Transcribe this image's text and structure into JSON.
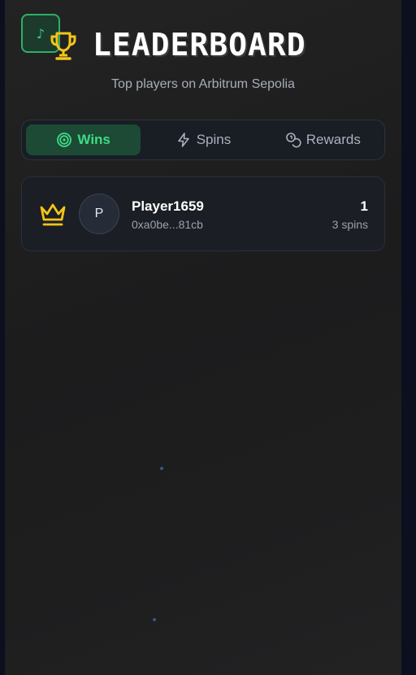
{
  "header": {
    "app_icon": "music-note-icon",
    "trophy_icon": "trophy-icon",
    "title": "LEADERBOARD",
    "subtitle": "Top players on Arbitrum Sepolia"
  },
  "tabs": [
    {
      "label": "Wins",
      "icon": "target-icon",
      "active": true
    },
    {
      "label": "Spins",
      "icon": "lightning-icon",
      "active": false
    },
    {
      "label": "Rewards",
      "icon": "coins-icon",
      "active": false
    }
  ],
  "leaderboard": [
    {
      "rank_icon": "crown-icon",
      "avatar_initial": "P",
      "name": "Player1659",
      "address": "0xa0be...81cb",
      "score": "1",
      "spins": "3 spins"
    }
  ],
  "colors": {
    "accent": "#3ddc84",
    "gold": "#f5c518",
    "background": "#1e1e1f"
  }
}
